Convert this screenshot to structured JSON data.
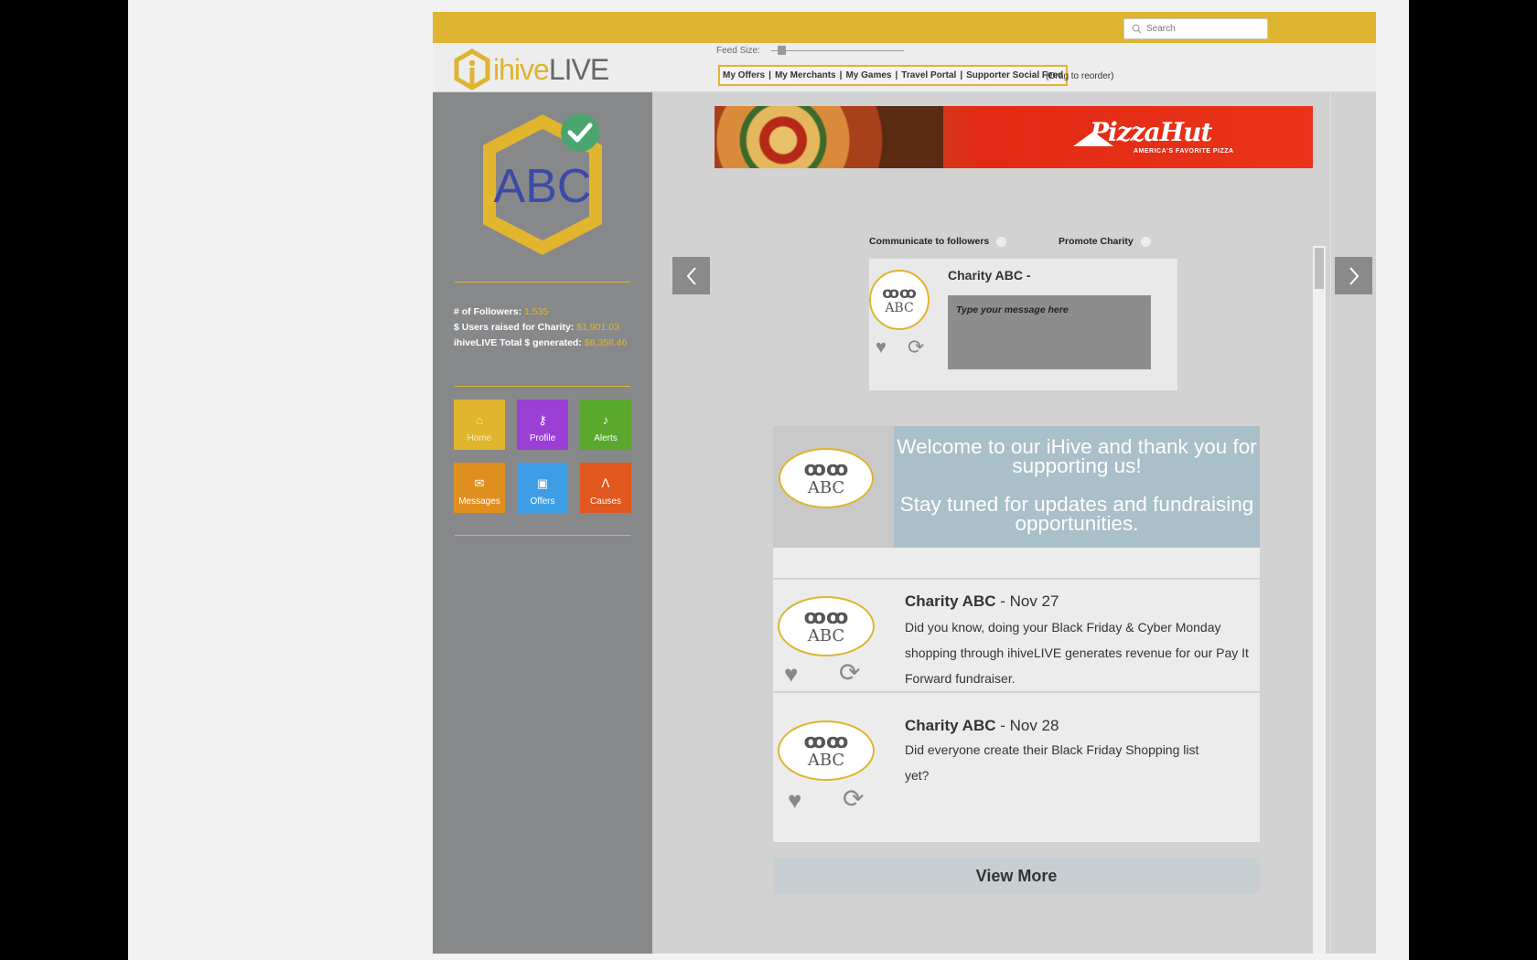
{
  "search": {
    "placeholder": "Search"
  },
  "brand": {
    "part1": "ihive",
    "part2": "LIVE"
  },
  "feed_size": {
    "label": "Feed Size:",
    "level": 0.05
  },
  "tabs": [
    "My Offers",
    "My Merchants",
    "My Games",
    "Travel Portal",
    "Supporter Social Feed"
  ],
  "reorder_hint": "(Drag to reorder)",
  "charity_badge": {
    "text": "ABC"
  },
  "stats": [
    {
      "label": "# of Followers:",
      "value": "1,535"
    },
    {
      "label": "$ Users  raised for Charity:",
      "value": "$1,901.03"
    },
    {
      "label": "ihiveLIVE Total $ generated:",
      "value": "$8,358.46"
    }
  ],
  "nav_tiles": [
    {
      "label": "Home",
      "color": "#e2b52f",
      "icon": "home-icon",
      "glyph": "⌂"
    },
    {
      "label": "Profile",
      "color": "#9b3fd6",
      "icon": "key-icon",
      "glyph": "⚷"
    },
    {
      "label": "Alerts",
      "color": "#5aa82e",
      "icon": "bell-icon",
      "glyph": "♪"
    },
    {
      "label": "Messages",
      "color": "#df8f1e",
      "icon": "envelope-icon",
      "glyph": "✉"
    },
    {
      "label": "Offers",
      "color": "#3d9ee6",
      "icon": "gift-icon",
      "glyph": "▣"
    },
    {
      "label": "Causes",
      "color": "#e0581e",
      "icon": "ribbon-icon",
      "glyph": "ᐱ"
    }
  ],
  "ad": {
    "brand": "PizzaHut",
    "tagline": "AMERICA'S FAVORITE PIZZA"
  },
  "options": {
    "communicate": "Communicate to followers",
    "promote": "Promote Charity"
  },
  "compose": {
    "name": "Charity ABC -",
    "placeholder": "Type your message here"
  },
  "logo_text": {
    "rings": "ꝏꝏ",
    "abc": "ABC"
  },
  "welcome": {
    "line1": "Welcome to our iHive and thank you for supporting us!",
    "line2": "Stay tuned for updates and fundraising opportunities."
  },
  "posts": [
    {
      "author": "Charity ABC",
      "date": " - Nov 27",
      "body": "Did you know, doing your Black Friday & Cyber Monday shopping through ihiveLIVE generates revenue for our Pay It Forward fundraiser."
    },
    {
      "author": "Charity ABC",
      "date": " - Nov 28",
      "body": "Did everyone create their Black Friday Shopping list yet?"
    }
  ],
  "view_more": "View More"
}
